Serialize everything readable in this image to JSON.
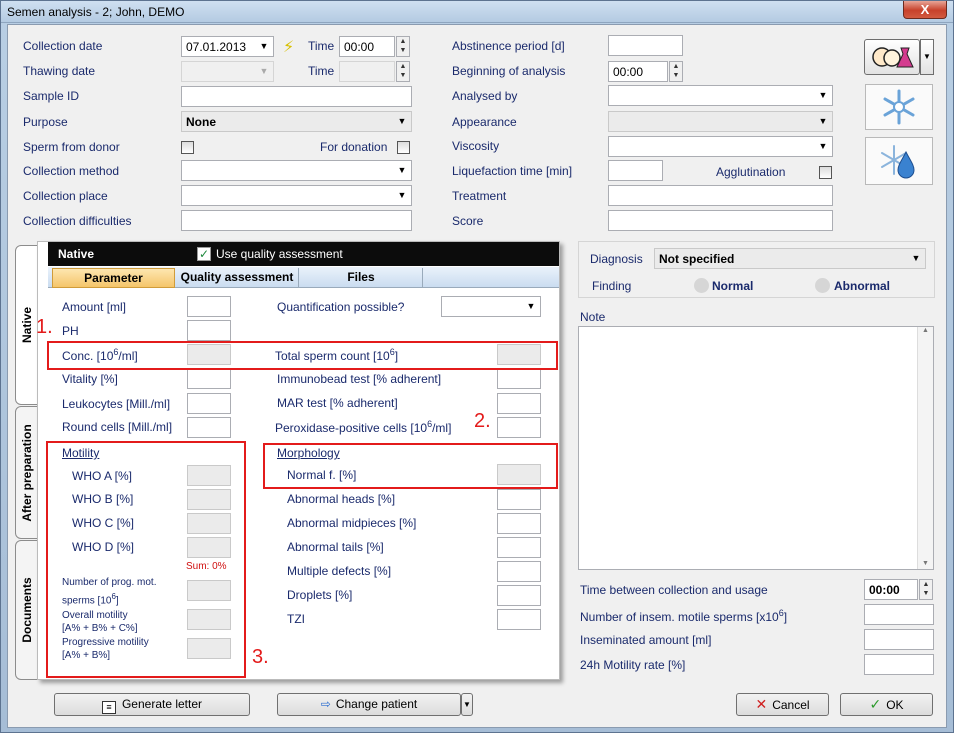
{
  "window": {
    "title": "Semen analysis - 2; John, DEMO",
    "close_glyph": "X"
  },
  "top_left": {
    "collection_date_label": "Collection date",
    "collection_date_value": "07.01.2013",
    "time_label": "Time",
    "time_value": "00:00",
    "thawing_date_label": "Thawing date",
    "thawing_time_label": "Time",
    "sample_id_label": "Sample ID",
    "purpose_label": "Purpose",
    "purpose_value": "None",
    "sperm_from_donor_label": "Sperm from donor",
    "for_donation_label": "For donation",
    "collection_method_label": "Collection method",
    "collection_place_label": "Collection place",
    "collection_difficulties_label": "Collection difficulties"
  },
  "top_right": {
    "abstinence_label": "Abstinence period [d]",
    "beginning_label": "Beginning of analysis",
    "beginning_value": "00:00",
    "analysed_by_label": "Analysed by",
    "appearance_label": "Appearance",
    "viscosity_label": "Viscosity",
    "liquefaction_label": "Liquefaction time [min]",
    "agglutination_label": "Agglutination",
    "treatment_label": "Treatment",
    "score_label": "Score"
  },
  "native_panel": {
    "header": "Native",
    "use_quality_label": "Use quality assessment",
    "tabs": [
      "Parameter",
      "Quality assessment",
      "Files"
    ],
    "amount_label": "Amount [ml]",
    "ph_label": "PH",
    "conc_label": "Conc. [10",
    "conc_sup": "6",
    "conc_tail": "/ml]",
    "vitality_label": "Vitality [%]",
    "leukocytes_label": "Leukocytes [Mill./ml]",
    "round_cells_label": "Round cells [Mill./ml]",
    "quant_label": "Quantification possible?",
    "total_label": "Total sperm count [10",
    "total_sup": "6",
    "total_tail": "]",
    "immunobead_label": "Immunobead test [% adherent]",
    "mar_label": "MAR test [% adherent]",
    "peroxidase_label": "Peroxidase-positive cells [10",
    "peroxidase_sup": "6",
    "peroxidase_tail": "/ml]",
    "motility_header": "Motility",
    "who_a": "WHO A [%]",
    "who_b": "WHO B [%]",
    "who_c": "WHO C [%]",
    "who_d": "WHO D [%]",
    "sum": "Sum: 0%",
    "prog_mot_line1": "Number of prog. mot.",
    "prog_mot_line2": "sperms [10",
    "prog_mot_sup": "6",
    "prog_mot_tail": "]",
    "overall_line1": "Overall motility",
    "overall_line2": "[A% + B% + C%]",
    "progressive_line1": "Progressive motility",
    "progressive_line2": "[A% + B%]",
    "morphology_header": "Morphology",
    "normal_f": "Normal f. [%]",
    "abnormal_heads": "Abnormal heads [%]",
    "abnormal_midpieces": "Abnormal midpieces [%]",
    "abnormal_tails": "Abnormal tails [%]",
    "multiple_defects": "Multiple defects [%]",
    "droplets": "Droplets [%]",
    "tzi": "TZI"
  },
  "side_tabs": [
    "Native",
    "After preparation",
    "Documents"
  ],
  "annotations": [
    "1.",
    "2.",
    "3."
  ],
  "diagnosis": {
    "label": "Diagnosis",
    "value": "Not specified",
    "finding_label": "Finding",
    "normal": "Normal",
    "abnormal": "Abnormal"
  },
  "note_label": "Note",
  "bottom_right": {
    "time_between_label": "Time between collection and usage",
    "time_between_value": "00:00",
    "insem_motile_label": "Number of insem. motile sperms [x10",
    "insem_motile_sup": "6",
    "insem_motile_tail": "]",
    "inseminated_amount_label": "Inseminated amount [ml]",
    "motility_rate_label": "24h Motility rate [%]"
  },
  "buttons": {
    "generate_letter": "Generate letter",
    "change_patient": "Change patient",
    "cancel": "Cancel",
    "ok": "OK"
  },
  "colors": {
    "accent_red": "#e31b1b",
    "label_blue": "#1a2a6c",
    "tab_orange": "#f5c56a"
  }
}
